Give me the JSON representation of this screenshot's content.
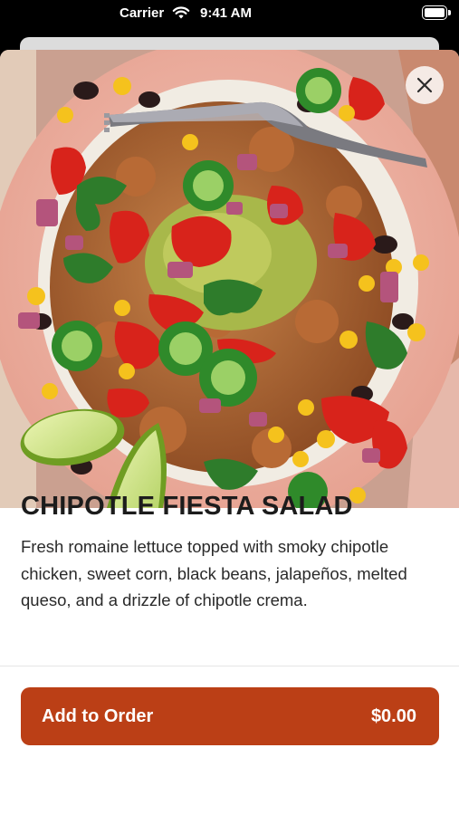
{
  "status_bar": {
    "carrier": "Carrier",
    "time": "9:41 AM",
    "wifi_icon": "wifi-icon",
    "battery_icon": "battery-icon"
  },
  "item": {
    "title": "CHIPOTLE FIESTA SALAD",
    "description": "Fresh romaine lettuce topped with smoky chipotle chicken, sweet corn, black beans, jalapeños, melted queso, and a drizzle of chipotle crema.",
    "image_alt": "Chipotle fiesta salad bowl"
  },
  "actions": {
    "close_icon": "close-icon",
    "add_label": "Add to Order",
    "price": "$0.00"
  },
  "colors": {
    "accent": "#bb3f16",
    "background": "#ffffff",
    "title_text": "#1c1c1c"
  }
}
